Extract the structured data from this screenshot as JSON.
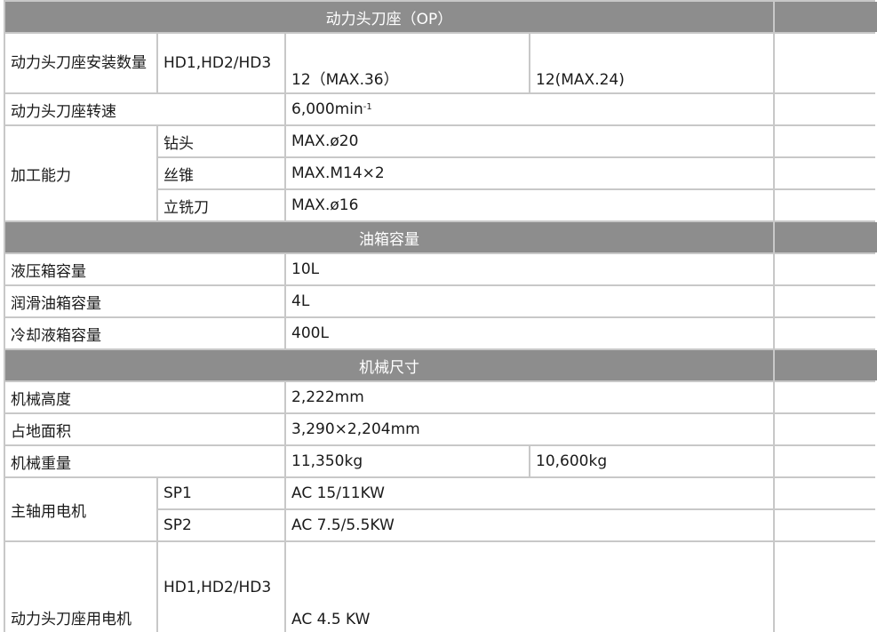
{
  "sections": {
    "turret": "动力头刀座（OP）",
    "tank": "油箱容量",
    "dims": "机械尺寸"
  },
  "turret": {
    "install_label": "动力头刀座安装数量",
    "install_sub": "HD1,HD2/HD3",
    "install_val1": "12（MAX.36）",
    "install_val2": "12(MAX.24)",
    "speed_label": "动力头刀座转速",
    "speed_val": "6,000min",
    "speed_sup": "-1",
    "capacity_label": "加工能力",
    "drill_label": "钻头",
    "drill_val": "MAX.ø20",
    "tap_label": "丝锥",
    "tap_val": "MAX.M14×2",
    "endmill_label": "立铣刀",
    "endmill_val": "MAX.ø16"
  },
  "tank": {
    "hydraulic_label": "液压箱容量",
    "hydraulic_val": "10L",
    "lube_label": "润滑油箱容量",
    "lube_val": "4L",
    "coolant_label": "冷却液箱容量",
    "coolant_val": "400L"
  },
  "dims": {
    "height_label": "机械高度",
    "height_val": "2,222mm",
    "floor_label": "占地面积",
    "floor_val": "3,290×2,204mm",
    "weight_label": "机械重量",
    "weight_val1": "11,350kg",
    "weight_val2": "10,600kg",
    "spindle_motor_label": "主轴用电机",
    "sp1_label": "SP1",
    "sp1_val": "AC 15/11KW",
    "sp2_label": "SP2",
    "sp2_val": "AC 7.5/5.5KW",
    "turret_motor_label": "动力头刀座用电机",
    "turret_motor_sub": "HD1,HD2/HD3",
    "turret_motor_val": "AC 4.5 KW"
  }
}
